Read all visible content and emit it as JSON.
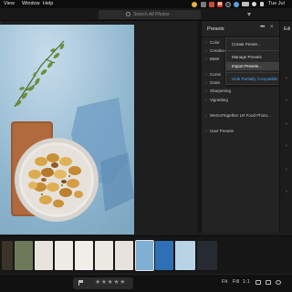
{
  "menubar": {
    "items": [
      "View",
      "Window",
      "Help"
    ],
    "clock": "Tue Jul"
  },
  "toolbar": {
    "search_placeholder": "Search All Photos"
  },
  "presets_panel": {
    "title": "Presets",
    "more_label": "•••",
    "close_label": "×",
    "groups": [
      {
        "label": "Color"
      },
      {
        "label": "Creative"
      },
      {
        "label": "B&W"
      },
      {
        "label": "Curve"
      },
      {
        "label": "Grain"
      },
      {
        "label": "Sharpening"
      },
      {
        "label": "Vignetting"
      },
      {
        "label": "WeGotTogether LR Food Photo..."
      },
      {
        "label": "User Presets"
      }
    ]
  },
  "dropdown": {
    "items": [
      {
        "label": "Create Preset..."
      },
      {
        "label": "Manage Presets"
      },
      {
        "label": "Import Presets..."
      },
      {
        "label": "Hide Partially Compatible Presets"
      }
    ]
  },
  "right_column": {
    "label": "Edi"
  },
  "bottombar": {
    "stars": "★★★★★",
    "fit_label": "Fit",
    "fill_label": "Fill",
    "ratio_label": "1:1"
  },
  "colors": {
    "accent_link": "#4fa3e8",
    "panel_bg": "#232323",
    "photo_bg": "#8fb7d0",
    "menu_selected": "#3f3f3f"
  },
  "icons": [
    "search-icon",
    "filter-icon",
    "more-icon",
    "close-icon",
    "chevron-right-icon",
    "flag-icon",
    "star-icon",
    "square-view-icon",
    "grid-view-icon",
    "crop-icon",
    "info-icon"
  ]
}
